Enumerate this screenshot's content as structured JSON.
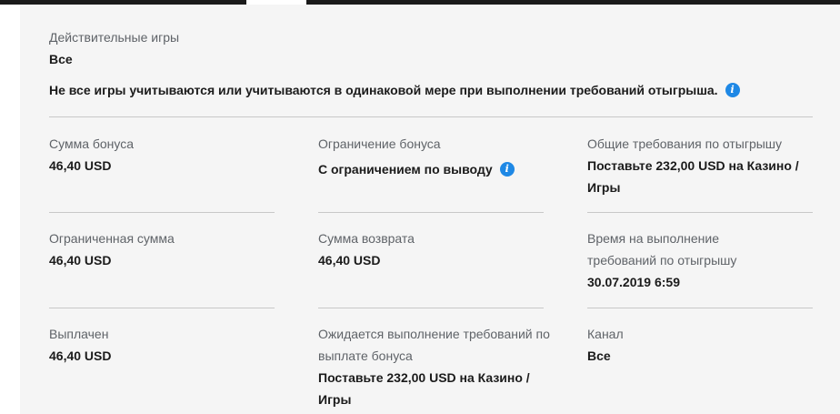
{
  "games": {
    "label": "Действительные игры",
    "value": "Все"
  },
  "note": {
    "text": "Не все игры учитываются или учитываются в одинаковой мере при выполнении требований отыгрыша."
  },
  "fields": {
    "bonus_amount": {
      "label": "Сумма бонуса",
      "value": "46,40 USD"
    },
    "bonus_limit": {
      "label": "Ограничение бонуса",
      "value": "С ограничением по выводу"
    },
    "wagering_total": {
      "label": "Общие требования по отыгрышу",
      "value": "Поставьте 232,00 USD на Казино / Игры"
    },
    "limited_amount": {
      "label": "Ограниченная сумма",
      "value": "46,40 USD"
    },
    "refund_amount": {
      "label": "Сумма возврата",
      "value": "46,40 USD"
    },
    "time_limit": {
      "label": "Время на выполнение требований по отыгрышу",
      "value": "30.07.2019 6:59"
    },
    "paid_out": {
      "label": "Выплачен",
      "value": "46,40 USD"
    },
    "pending_payout": {
      "label": "Ожидается выполнение требований по выплате бонуса",
      "value": "Поставьте 232,00 USD на Казино / Игры"
    },
    "channel": {
      "label": "Канал",
      "value": "Все"
    }
  },
  "icons": {
    "info": "info-icon"
  },
  "colors": {
    "accent": "#1e88e5",
    "panel": "#f5f5f5",
    "topbar": "#1a1a1a"
  }
}
